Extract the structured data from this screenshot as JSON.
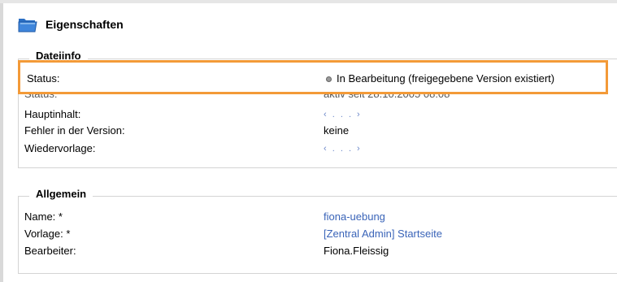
{
  "header": {
    "title": "Eigenschaften",
    "icon": "folder-icon"
  },
  "dateiinfo": {
    "legend": "Dateiinfo",
    "status_highlight": {
      "label": "Status:",
      "value": "In Bearbeitung (freigegebene Version existiert)"
    },
    "status_hidden": {
      "label": "Status:",
      "value": "aktiv seit 28.10.2005 08:08"
    },
    "rows": [
      {
        "label": "Hauptinhalt:",
        "value": "‹ . . . ›"
      },
      {
        "label": "Fehler in der Version:",
        "value": "keine"
      },
      {
        "label": "Wiedervorlage:",
        "value": "‹ . . . ›"
      }
    ]
  },
  "allgemein": {
    "legend": "Allgemein",
    "rows": [
      {
        "label": "Name: *",
        "value": "fiona-uebung"
      },
      {
        "label": "Vorlage: *",
        "value": "[Zentral Admin] Startseite"
      },
      {
        "label": "Bearbeiter:",
        "value": "Fiona.Fleissig"
      }
    ]
  },
  "colors": {
    "highlight": "#f39a38",
    "link": "#3a64b8",
    "border": "#d4d4d4"
  }
}
